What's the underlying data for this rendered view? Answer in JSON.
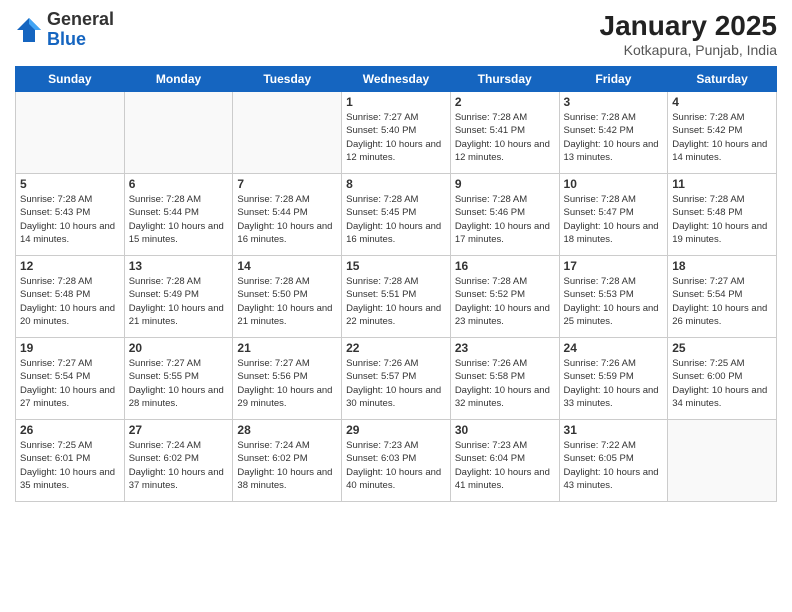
{
  "header": {
    "logo_general": "General",
    "logo_blue": "Blue",
    "month_title": "January 2025",
    "location": "Kotkapura, Punjab, India"
  },
  "days_of_week": [
    "Sunday",
    "Monday",
    "Tuesday",
    "Wednesday",
    "Thursday",
    "Friday",
    "Saturday"
  ],
  "weeks": [
    [
      {
        "day": "",
        "sunrise": "",
        "sunset": "",
        "daylight": "",
        "empty": true
      },
      {
        "day": "",
        "sunrise": "",
        "sunset": "",
        "daylight": "",
        "empty": true
      },
      {
        "day": "",
        "sunrise": "",
        "sunset": "",
        "daylight": "",
        "empty": true
      },
      {
        "day": "1",
        "sunrise": "Sunrise: 7:27 AM",
        "sunset": "Sunset: 5:40 PM",
        "daylight": "Daylight: 10 hours and 12 minutes.",
        "empty": false
      },
      {
        "day": "2",
        "sunrise": "Sunrise: 7:28 AM",
        "sunset": "Sunset: 5:41 PM",
        "daylight": "Daylight: 10 hours and 12 minutes.",
        "empty": false
      },
      {
        "day": "3",
        "sunrise": "Sunrise: 7:28 AM",
        "sunset": "Sunset: 5:42 PM",
        "daylight": "Daylight: 10 hours and 13 minutes.",
        "empty": false
      },
      {
        "day": "4",
        "sunrise": "Sunrise: 7:28 AM",
        "sunset": "Sunset: 5:42 PM",
        "daylight": "Daylight: 10 hours and 14 minutes.",
        "empty": false
      }
    ],
    [
      {
        "day": "5",
        "sunrise": "Sunrise: 7:28 AM",
        "sunset": "Sunset: 5:43 PM",
        "daylight": "Daylight: 10 hours and 14 minutes.",
        "empty": false
      },
      {
        "day": "6",
        "sunrise": "Sunrise: 7:28 AM",
        "sunset": "Sunset: 5:44 PM",
        "daylight": "Daylight: 10 hours and 15 minutes.",
        "empty": false
      },
      {
        "day": "7",
        "sunrise": "Sunrise: 7:28 AM",
        "sunset": "Sunset: 5:44 PM",
        "daylight": "Daylight: 10 hours and 16 minutes.",
        "empty": false
      },
      {
        "day": "8",
        "sunrise": "Sunrise: 7:28 AM",
        "sunset": "Sunset: 5:45 PM",
        "daylight": "Daylight: 10 hours and 16 minutes.",
        "empty": false
      },
      {
        "day": "9",
        "sunrise": "Sunrise: 7:28 AM",
        "sunset": "Sunset: 5:46 PM",
        "daylight": "Daylight: 10 hours and 17 minutes.",
        "empty": false
      },
      {
        "day": "10",
        "sunrise": "Sunrise: 7:28 AM",
        "sunset": "Sunset: 5:47 PM",
        "daylight": "Daylight: 10 hours and 18 minutes.",
        "empty": false
      },
      {
        "day": "11",
        "sunrise": "Sunrise: 7:28 AM",
        "sunset": "Sunset: 5:48 PM",
        "daylight": "Daylight: 10 hours and 19 minutes.",
        "empty": false
      }
    ],
    [
      {
        "day": "12",
        "sunrise": "Sunrise: 7:28 AM",
        "sunset": "Sunset: 5:48 PM",
        "daylight": "Daylight: 10 hours and 20 minutes.",
        "empty": false
      },
      {
        "day": "13",
        "sunrise": "Sunrise: 7:28 AM",
        "sunset": "Sunset: 5:49 PM",
        "daylight": "Daylight: 10 hours and 21 minutes.",
        "empty": false
      },
      {
        "day": "14",
        "sunrise": "Sunrise: 7:28 AM",
        "sunset": "Sunset: 5:50 PM",
        "daylight": "Daylight: 10 hours and 21 minutes.",
        "empty": false
      },
      {
        "day": "15",
        "sunrise": "Sunrise: 7:28 AM",
        "sunset": "Sunset: 5:51 PM",
        "daylight": "Daylight: 10 hours and 22 minutes.",
        "empty": false
      },
      {
        "day": "16",
        "sunrise": "Sunrise: 7:28 AM",
        "sunset": "Sunset: 5:52 PM",
        "daylight": "Daylight: 10 hours and 23 minutes.",
        "empty": false
      },
      {
        "day": "17",
        "sunrise": "Sunrise: 7:28 AM",
        "sunset": "Sunset: 5:53 PM",
        "daylight": "Daylight: 10 hours and 25 minutes.",
        "empty": false
      },
      {
        "day": "18",
        "sunrise": "Sunrise: 7:27 AM",
        "sunset": "Sunset: 5:54 PM",
        "daylight": "Daylight: 10 hours and 26 minutes.",
        "empty": false
      }
    ],
    [
      {
        "day": "19",
        "sunrise": "Sunrise: 7:27 AM",
        "sunset": "Sunset: 5:54 PM",
        "daylight": "Daylight: 10 hours and 27 minutes.",
        "empty": false
      },
      {
        "day": "20",
        "sunrise": "Sunrise: 7:27 AM",
        "sunset": "Sunset: 5:55 PM",
        "daylight": "Daylight: 10 hours and 28 minutes.",
        "empty": false
      },
      {
        "day": "21",
        "sunrise": "Sunrise: 7:27 AM",
        "sunset": "Sunset: 5:56 PM",
        "daylight": "Daylight: 10 hours and 29 minutes.",
        "empty": false
      },
      {
        "day": "22",
        "sunrise": "Sunrise: 7:26 AM",
        "sunset": "Sunset: 5:57 PM",
        "daylight": "Daylight: 10 hours and 30 minutes.",
        "empty": false
      },
      {
        "day": "23",
        "sunrise": "Sunrise: 7:26 AM",
        "sunset": "Sunset: 5:58 PM",
        "daylight": "Daylight: 10 hours and 32 minutes.",
        "empty": false
      },
      {
        "day": "24",
        "sunrise": "Sunrise: 7:26 AM",
        "sunset": "Sunset: 5:59 PM",
        "daylight": "Daylight: 10 hours and 33 minutes.",
        "empty": false
      },
      {
        "day": "25",
        "sunrise": "Sunrise: 7:25 AM",
        "sunset": "Sunset: 6:00 PM",
        "daylight": "Daylight: 10 hours and 34 minutes.",
        "empty": false
      }
    ],
    [
      {
        "day": "26",
        "sunrise": "Sunrise: 7:25 AM",
        "sunset": "Sunset: 6:01 PM",
        "daylight": "Daylight: 10 hours and 35 minutes.",
        "empty": false
      },
      {
        "day": "27",
        "sunrise": "Sunrise: 7:24 AM",
        "sunset": "Sunset: 6:02 PM",
        "daylight": "Daylight: 10 hours and 37 minutes.",
        "empty": false
      },
      {
        "day": "28",
        "sunrise": "Sunrise: 7:24 AM",
        "sunset": "Sunset: 6:02 PM",
        "daylight": "Daylight: 10 hours and 38 minutes.",
        "empty": false
      },
      {
        "day": "29",
        "sunrise": "Sunrise: 7:23 AM",
        "sunset": "Sunset: 6:03 PM",
        "daylight": "Daylight: 10 hours and 40 minutes.",
        "empty": false
      },
      {
        "day": "30",
        "sunrise": "Sunrise: 7:23 AM",
        "sunset": "Sunset: 6:04 PM",
        "daylight": "Daylight: 10 hours and 41 minutes.",
        "empty": false
      },
      {
        "day": "31",
        "sunrise": "Sunrise: 7:22 AM",
        "sunset": "Sunset: 6:05 PM",
        "daylight": "Daylight: 10 hours and 43 minutes.",
        "empty": false
      },
      {
        "day": "",
        "sunrise": "",
        "sunset": "",
        "daylight": "",
        "empty": true
      }
    ]
  ]
}
